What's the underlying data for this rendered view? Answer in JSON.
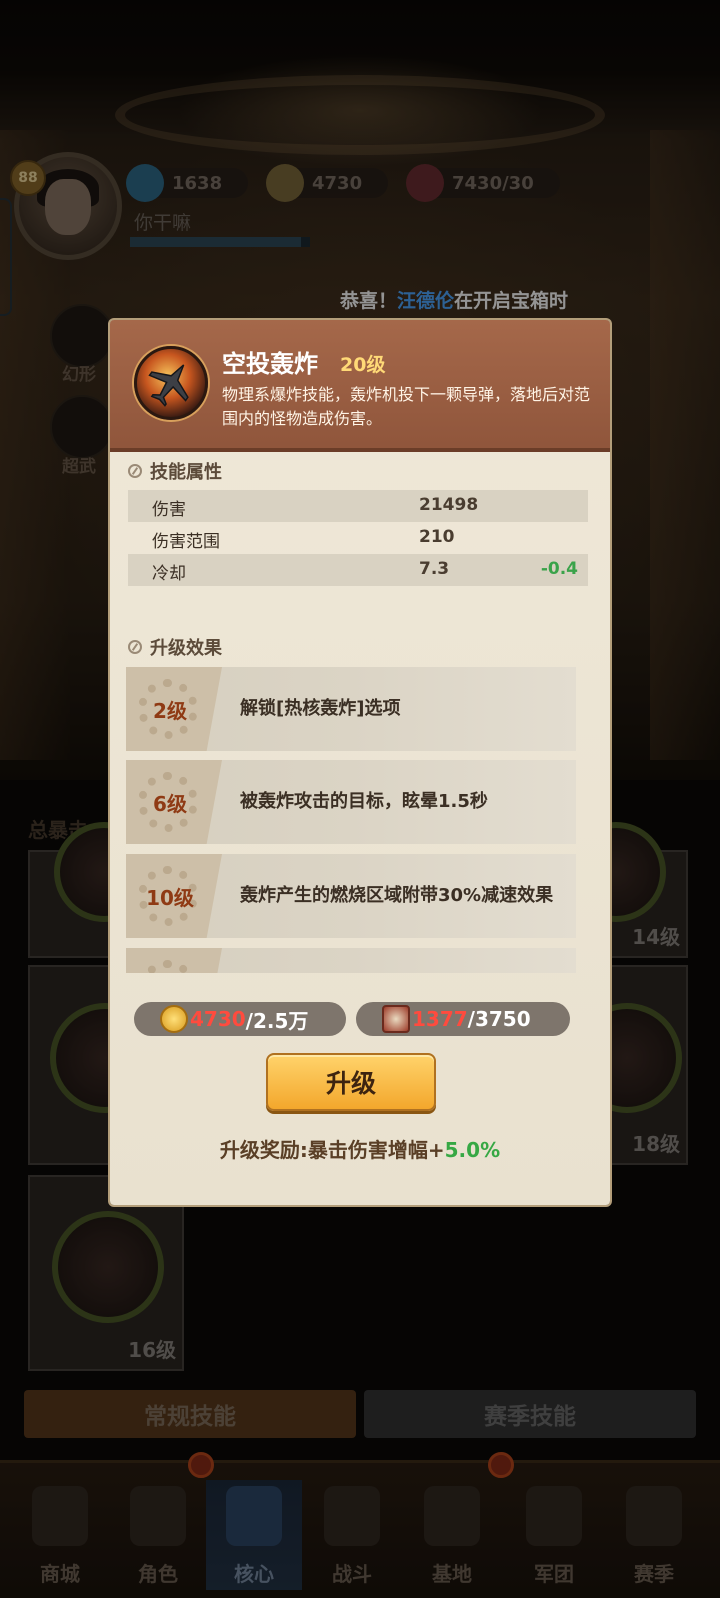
{
  "player": {
    "level": "88",
    "name": "你干嘛",
    "resources": [
      {
        "icon": "gem-icon",
        "value": "1638"
      },
      {
        "icon": "coin-icon",
        "value": "4730"
      },
      {
        "icon": "energy-icon",
        "value": "7430/30"
      }
    ],
    "exp_progress": 0.95
  },
  "marquee": {
    "prefix": "恭喜！",
    "name": "汪德伦",
    "suffix": "在开启宝箱时"
  },
  "side_buttons": [
    {
      "label": "幻形",
      "icon": "cat-icon"
    },
    {
      "label": "超武",
      "icon": "weapon-icon"
    }
  ],
  "background": {
    "total_crit_label": "总暴击",
    "card_levels": [
      "14级",
      "18级",
      "16级"
    ]
  },
  "skill": {
    "name": "空投轰炸",
    "level": "20级",
    "description": "物理系爆炸技能，轰炸机投下一颗导弹，落地后对范围内的怪物造成伤害。",
    "icon": "bomber-jet-icon"
  },
  "attributes": {
    "title": "技能属性",
    "rows": [
      {
        "name": "伤害",
        "value": "21498",
        "delta": ""
      },
      {
        "name": "伤害范围",
        "value": "210",
        "delta": ""
      },
      {
        "name": "冷却",
        "value": "7.3",
        "delta": "-0.4"
      }
    ]
  },
  "upgrades": {
    "title": "升级效果",
    "rows": [
      {
        "level": "2级",
        "text": "解锁[热核轰炸]选项"
      },
      {
        "level": "6级",
        "text": "被轰炸攻击的目标，眩晕1.5秒"
      },
      {
        "level": "10级",
        "text": "轰炸产生的燃烧区域附带30%减速效果"
      },
      {
        "level": "",
        "text": ""
      }
    ]
  },
  "costs": [
    {
      "icon": "coin-icon",
      "have": "4730",
      "need": "/2.5万"
    },
    {
      "icon": "skill-book-icon",
      "have": "1377",
      "need": "/3750"
    }
  ],
  "upgrade_button": "升级",
  "reward": {
    "label": "升级奖励:暴击伤害增幅+",
    "value": "5.0%"
  },
  "tabs": {
    "normal": "常规技能",
    "season": "赛季技能"
  },
  "nav": [
    {
      "label": "商城",
      "icon": "shop-icon"
    },
    {
      "label": "角色",
      "icon": "character-icon"
    },
    {
      "label": "核心",
      "icon": "core-icon",
      "active": true
    },
    {
      "label": "战斗",
      "icon": "battle-icon"
    },
    {
      "label": "基地",
      "icon": "base-icon"
    },
    {
      "label": "军团",
      "icon": "legion-icon"
    },
    {
      "label": "赛季",
      "icon": "season-icon"
    }
  ],
  "colors": {
    "header": "#9a5d42",
    "panel": "#ece5d4",
    "accent_gold": "#f3a72c",
    "delta_green": "#3aa34a",
    "have_red": "#ff4b3e"
  }
}
